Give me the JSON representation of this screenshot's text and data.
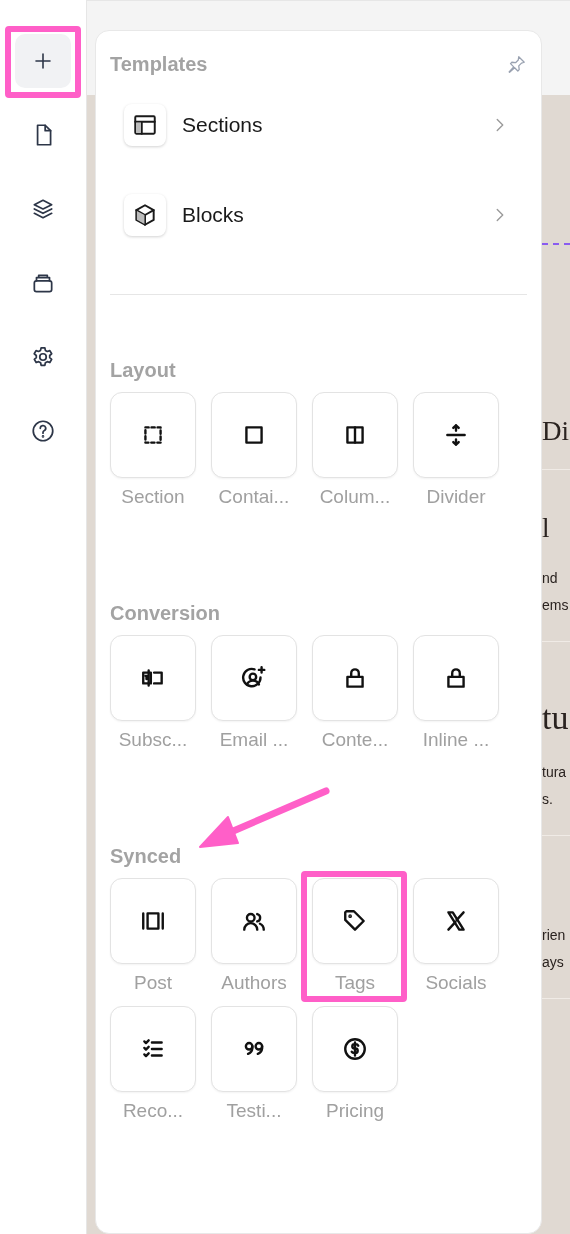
{
  "sidebar": {
    "items": [
      {
        "selected": true,
        "highlighted": true
      },
      {
        "selected": false,
        "highlighted": false
      },
      {
        "selected": false,
        "highlighted": false
      },
      {
        "selected": false,
        "highlighted": false
      },
      {
        "selected": false,
        "highlighted": false
      },
      {
        "selected": false,
        "highlighted": false
      }
    ]
  },
  "panel": {
    "title": "Templates",
    "templates": [
      {
        "label": "Sections"
      },
      {
        "label": "Blocks"
      }
    ],
    "groups": [
      {
        "title": "Layout",
        "pointer": false,
        "items": [
          {
            "label": "Section",
            "highlighted": false
          },
          {
            "label": "Contai...",
            "highlighted": false
          },
          {
            "label": "Colum...",
            "highlighted": false
          },
          {
            "label": "Divider",
            "highlighted": false
          }
        ]
      },
      {
        "title": "Conversion",
        "pointer": false,
        "items": [
          {
            "label": "Subsc...",
            "highlighted": false
          },
          {
            "label": "Email ...",
            "highlighted": false
          },
          {
            "label": "Conte...",
            "highlighted": false
          },
          {
            "label": "Inline ...",
            "highlighted": false
          }
        ]
      },
      {
        "title": "Synced",
        "pointer": true,
        "items": [
          {
            "label": "Post",
            "highlighted": false
          },
          {
            "label": "Authors",
            "highlighted": false
          },
          {
            "label": "Tags",
            "highlighted": true
          },
          {
            "label": "Socials",
            "highlighted": false
          },
          {
            "label": "Reco...",
            "highlighted": false
          },
          {
            "label": "Testi...",
            "highlighted": false
          },
          {
            "label": "Pricing",
            "highlighted": false
          }
        ]
      }
    ]
  },
  "canvas": {
    "sections": [
      {
        "heading": "Di"
      },
      {
        "heading": "l",
        "lines": [
          "nd",
          "ems"
        ]
      },
      {
        "heading": "tu",
        "lines": [
          "tura",
          "s."
        ]
      },
      {
        "lines": [
          "rien",
          "ays"
        ]
      }
    ]
  }
}
